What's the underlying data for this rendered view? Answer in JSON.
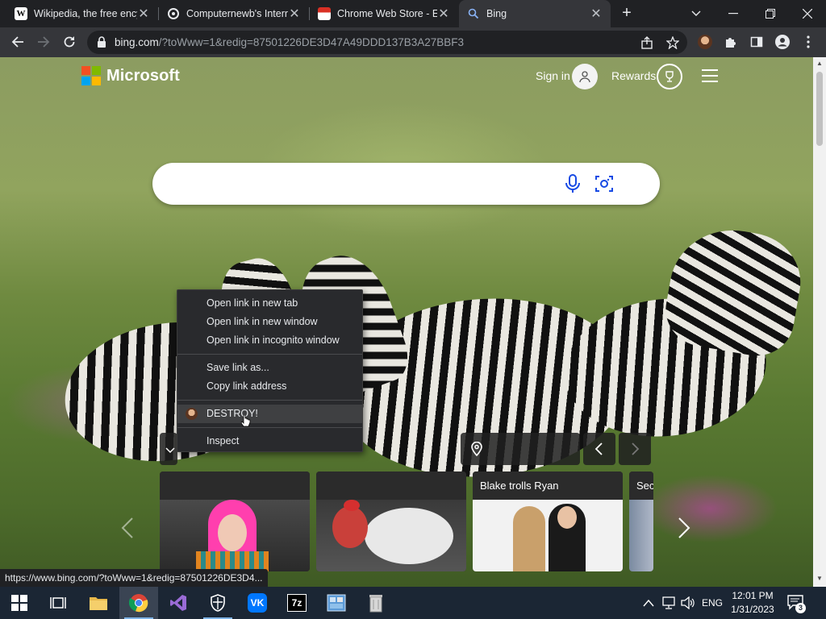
{
  "tabs": [
    {
      "title": "Wikipedia, the free encyclopedia",
      "favicon": "wikipedia-favicon",
      "active": false
    },
    {
      "title": "Computernewb's Internet Archive",
      "favicon": "computernewb-favicon",
      "active": false
    },
    {
      "title": "Chrome Web Store - Extensions",
      "favicon": "chrome-web-store-favicon",
      "active": false
    },
    {
      "title": "Bing",
      "favicon": "bing-search-favicon",
      "active": true
    }
  ],
  "address_bar": {
    "host": "bing.com",
    "path": "/?toWww=1&redig=87501226DE3D47A49DDD137B3A27BBF3"
  },
  "bing": {
    "brand": "Microsoft",
    "sign_in": "Sign in",
    "rewards": "Rewards",
    "search_placeholder": "",
    "carousel": [
      {
        "caption": ""
      },
      {
        "caption": ""
      },
      {
        "caption": "Blake trolls Ryan"
      },
      {
        "caption": "Sec"
      }
    ]
  },
  "context_menu": {
    "items": [
      "Open link in new tab",
      "Open link in new window",
      "Open link in incognito window",
      "Save link as...",
      "Copy link address",
      "DESTROY!",
      "Inspect"
    ]
  },
  "status_url": "https://www.bing.com/?toWww=1&redig=87501226DE3D4...",
  "taskbar": {
    "language": "ENG",
    "time": "12:01 PM",
    "date": "1/31/2023",
    "notification_count": "3"
  },
  "colors": {
    "chrome_dark": "#202124",
    "chrome_toolbar": "#35363a",
    "taskbar": "#1b2634",
    "ms_red": "#f25022",
    "ms_green": "#7fba00",
    "ms_blue": "#00a4ef",
    "ms_yellow": "#ffb900",
    "bing_accent": "#174ae4"
  }
}
